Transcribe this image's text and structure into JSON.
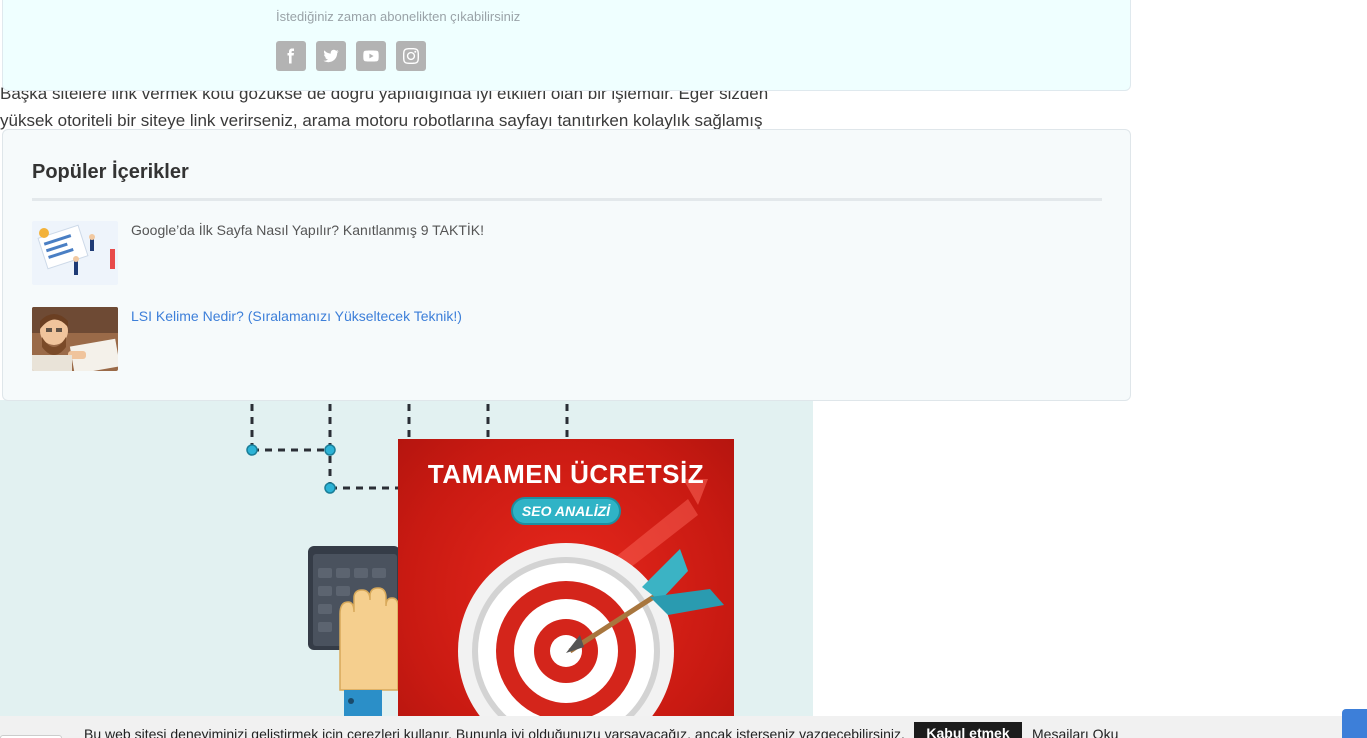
{
  "article": {
    "line1": "Başka sitelere link vermek kötü gözükse de doğru yapıldığında iyi etkileri olan bir işlemdir. Eğer sizden",
    "line2": "yüksek otoriteli bir siteye link verirseniz, arama motoru robotlarına sayfayı tanıtırken kolaylık sağlamış"
  },
  "newsletter": {
    "note": "İstediğiniz zaman abonelikten çıkabilirsiniz",
    "social": [
      {
        "icon": "facebook-icon"
      },
      {
        "icon": "twitter-icon"
      },
      {
        "icon": "youtube-icon"
      },
      {
        "icon": "instagram-icon"
      }
    ]
  },
  "popular": {
    "title": "Popüler İçerikler",
    "posts": [
      {
        "title": "Google’da İlk Sayfa Nasıl Yapılır? Kanıtlanmış 9 TAKTİK!"
      },
      {
        "title": "LSI Kelime Nedir? (Sıralamanızı Yükseltecek Teknik!)"
      }
    ]
  },
  "ad": {
    "headline": "TAMAMEN ÜCRETSİZ",
    "pill": "SEO ANALİZİ"
  },
  "cookie": {
    "message": "Bu web sitesi deneyiminizi geliştirmek için çerezleri kullanır. Bununla iyi olduğunuzu varsayacağız, ancak isterseniz vazgeçebilirsiniz.",
    "accept": "Kabul etmek",
    "read": "Mesajları Oku"
  },
  "colors": {
    "link": "#3d7fd9",
    "ad_red": "#d9241a",
    "social_gray": "#b3b3b3",
    "accent_teal": "#2fb3c6"
  }
}
